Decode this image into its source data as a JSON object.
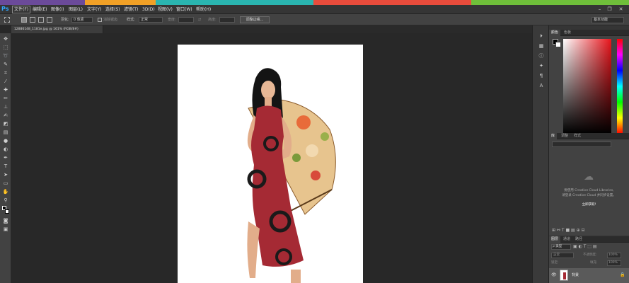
{
  "colors": {
    "bar_segments": [
      "#6b4a9a",
      "#f0a026",
      "#2ab5b0",
      "#e84c3c",
      "#6fbf3a"
    ],
    "accent": "#31a8ff"
  },
  "app": {
    "logo": "Ps"
  },
  "menu": {
    "items": [
      "文件(F)",
      "编辑(E)",
      "图像(I)",
      "图层(L)",
      "文字(Y)",
      "选择(S)",
      "滤镜(T)",
      "3D(D)",
      "视图(V)",
      "窗口(W)",
      "帮助(H)"
    ]
  },
  "window_controls": {
    "minimize": "–",
    "restore": "❐",
    "close": "✕"
  },
  "options": {
    "feather_label": "羽化:",
    "feather_value": "0 像素",
    "antialias_label": "消除锯齿",
    "style_label": "样式:",
    "style_value": "正常",
    "width_label": "宽度:",
    "height_label": "高度:",
    "refine_button": "调整边缘...",
    "workspace": "基本功能"
  },
  "document": {
    "tab_title": "12886148_1181e.jpg @ 161% (RGB/8#)"
  },
  "tools": [
    "move-icon",
    "marquee-icon",
    "lasso-icon",
    "quick-select-icon",
    "crop-icon",
    "eyedropper-icon",
    "healing-icon",
    "brush-icon",
    "stamp-icon",
    "history-brush-icon",
    "eraser-icon",
    "gradient-icon",
    "blur-icon",
    "dodge-icon",
    "pen-icon",
    "type-icon",
    "path-select-icon",
    "shape-icon",
    "hand-icon",
    "zoom-icon"
  ],
  "panels": {
    "color_tabs": [
      "颜色",
      "色板"
    ],
    "library_tabs": [
      "库",
      "调整",
      "样式"
    ],
    "library_message_1": "要使用 Creative Cloud Libraries,",
    "library_message_2": "请登录 Creative Cloud 并同步设置。",
    "library_link": "立即获取!",
    "layers_tabs": [
      "图层",
      "通道",
      "路径"
    ],
    "kind_label": "ρ 类型",
    "blend_mode": "正常",
    "opacity_label": "不透明度:",
    "opacity_value": "100%",
    "lock_label": "锁定:",
    "fill_label": "填充:",
    "fill_value": "100%",
    "layer_name": "背景"
  }
}
